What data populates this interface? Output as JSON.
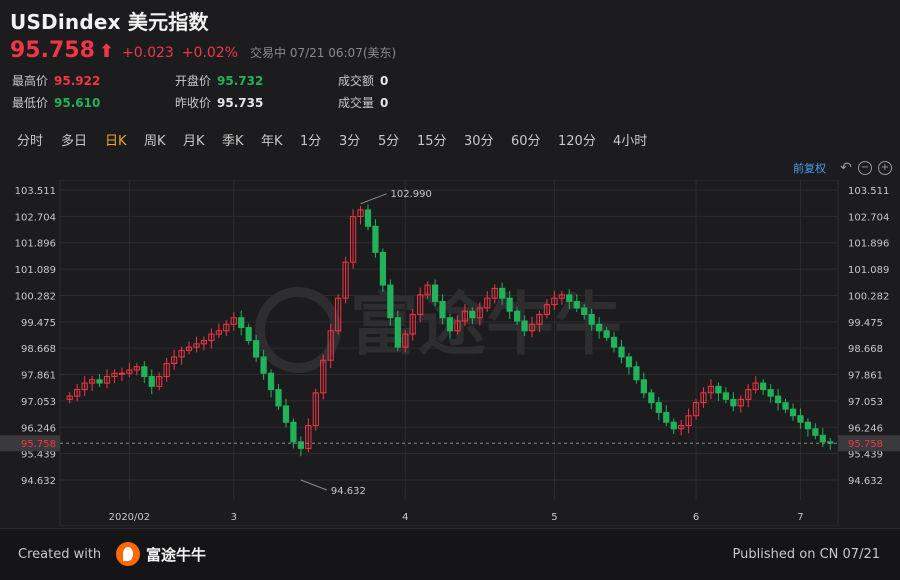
{
  "header": {
    "title": "USDindex 美元指数",
    "price": "95.758",
    "change": "+0.023",
    "change_pct": "+0.02%",
    "status": "交易中  07/21 06:07(美东)"
  },
  "stats": [
    {
      "label": "最高价",
      "value": "95.922",
      "color": "red"
    },
    {
      "label": "开盘价",
      "value": "95.732",
      "color": "green"
    },
    {
      "label": "成交额",
      "value": "0",
      "color": "white"
    },
    {
      "label": "最低价",
      "value": "95.610",
      "color": "green"
    },
    {
      "label": "昨收价",
      "value": "95.735",
      "color": "white"
    },
    {
      "label": "成交量",
      "value": "0",
      "color": "white"
    }
  ],
  "tabs": [
    "分时",
    "多日",
    "日K",
    "周K",
    "月K",
    "季K",
    "年K",
    "1分",
    "3分",
    "5分",
    "15分",
    "30分",
    "60分",
    "120分",
    "4小时"
  ],
  "active_tab": "日K",
  "toolbar": {
    "adjust_label": "前复权"
  },
  "watermark": "富途牛牛",
  "chart_data": {
    "type": "candlestick",
    "y_ticks": [
      "103.511",
      "102.704",
      "101.896",
      "101.089",
      "100.282",
      "99.475",
      "98.668",
      "97.861",
      "97.053",
      "96.246",
      "95.439",
      "94.632"
    ],
    "x_ticks": [
      "2020/02",
      "3",
      "4",
      "5",
      "6",
      "7"
    ],
    "ylim": [
      94.632,
      103.511
    ],
    "current_price": "95.758",
    "high_annotation": "102.990",
    "low_annotation": "94.632",
    "colors": {
      "up": "#f23645",
      "down": "#21b35a",
      "grid": "#2d2d30"
    },
    "approx_closes": [
      97.2,
      97.4,
      97.6,
      97.7,
      97.6,
      97.8,
      97.9,
      97.9,
      98.0,
      98.1,
      97.8,
      97.5,
      97.8,
      98.2,
      98.4,
      98.6,
      98.7,
      98.8,
      98.9,
      99.1,
      99.2,
      99.4,
      99.6,
      99.3,
      98.9,
      98.4,
      97.9,
      97.4,
      96.9,
      96.4,
      95.8,
      95.6,
      96.3,
      97.3,
      98.3,
      99.2,
      100.2,
      101.3,
      102.7,
      102.9,
      102.4,
      101.6,
      100.6,
      99.6,
      98.7,
      99.1,
      99.7,
      100.3,
      100.6,
      100.1,
      99.6,
      99.2,
      99.5,
      99.8,
      99.6,
      99.9,
      100.2,
      100.5,
      100.2,
      99.8,
      99.5,
      99.2,
      99.4,
      99.7,
      100.0,
      100.2,
      100.3,
      100.1,
      99.9,
      99.7,
      99.4,
      99.2,
      99.0,
      98.7,
      98.4,
      98.1,
      97.7,
      97.3,
      97.0,
      96.7,
      96.4,
      96.2,
      96.3,
      96.6,
      97.0,
      97.3,
      97.5,
      97.3,
      97.1,
      96.9,
      97.1,
      97.4,
      97.6,
      97.4,
      97.2,
      97.0,
      96.8,
      96.6,
      96.4,
      96.2,
      96.0,
      95.8,
      95.76
    ],
    "approx_opens": [
      97.1,
      97.2,
      97.4,
      97.6,
      97.7,
      97.6,
      97.8,
      97.9,
      97.9,
      98.0,
      98.1,
      97.8,
      97.5,
      97.8,
      98.2,
      98.4,
      98.6,
      98.7,
      98.8,
      98.9,
      99.1,
      99.2,
      99.4,
      99.6,
      99.3,
      98.9,
      98.4,
      97.9,
      97.4,
      96.9,
      96.4,
      95.8,
      95.6,
      96.3,
      97.3,
      98.3,
      99.2,
      100.2,
      101.3,
      102.7,
      102.9,
      102.4,
      101.6,
      100.6,
      99.6,
      98.7,
      99.1,
      99.7,
      100.3,
      100.6,
      100.1,
      99.6,
      99.2,
      99.5,
      99.8,
      99.6,
      99.9,
      100.2,
      100.5,
      100.2,
      99.8,
      99.5,
      99.2,
      99.4,
      99.7,
      100.0,
      100.2,
      100.3,
      100.1,
      99.9,
      99.7,
      99.4,
      99.2,
      99.0,
      98.7,
      98.4,
      98.1,
      97.7,
      97.3,
      97.0,
      96.7,
      96.4,
      96.2,
      96.3,
      96.6,
      97.0,
      97.3,
      97.5,
      97.3,
      97.1,
      96.9,
      97.1,
      97.4,
      97.6,
      97.4,
      97.2,
      97.0,
      96.8,
      96.6,
      96.4,
      96.2,
      96.0,
      95.8
    ]
  },
  "footer": {
    "created_label": "Created with",
    "logo_text": "富途牛牛",
    "published": "Published on CN 07/21"
  }
}
